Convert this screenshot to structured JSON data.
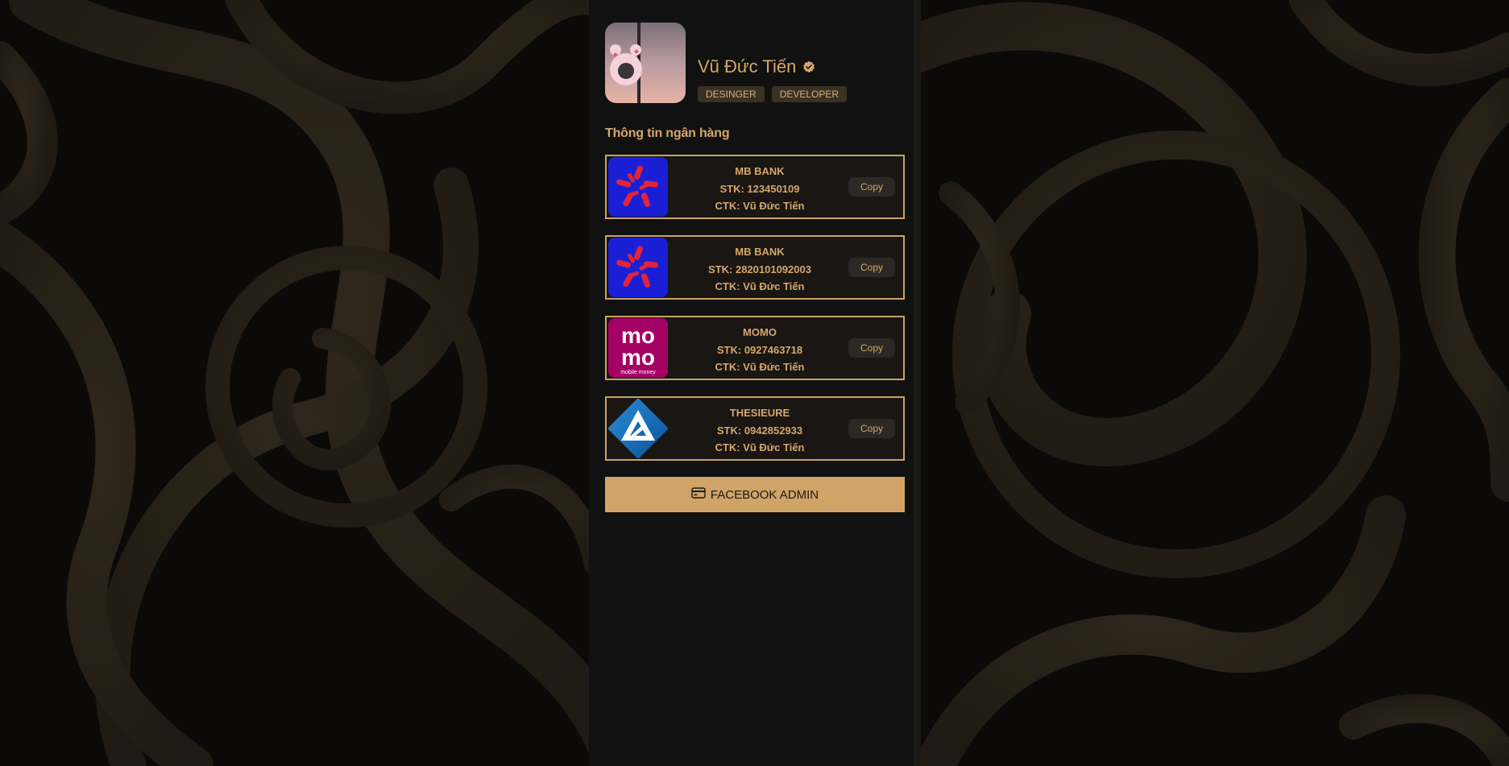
{
  "profile": {
    "name": "Vũ Đức Tiến",
    "verified_icon": "verified-check-icon",
    "tags": [
      "DESINGER",
      "DEVELOPER"
    ]
  },
  "section": {
    "title": "Thông tin ngân hàng"
  },
  "banks": [
    {
      "name": "MB BANK",
      "account": "STK: 123450109",
      "holder": "CTK: Vũ Đức Tiến",
      "logo": "mb-bank-logo",
      "copy_label": "Copy"
    },
    {
      "name": "MB BANK",
      "account": "STK: 2820101092003",
      "holder": "CTK: Vũ Đức Tiến",
      "logo": "mb-bank-logo",
      "copy_label": "Copy"
    },
    {
      "name": "MOMO",
      "account": "STK: 0927463718",
      "holder": "CTK: Vũ Đức Tiến",
      "logo": "momo-logo",
      "logo_text": [
        "mo",
        "mo",
        "mobile money"
      ],
      "copy_label": "Copy"
    },
    {
      "name": "THESIEURE",
      "account": "STK: 0942852933",
      "holder": "CTK: Vũ Đức Tiến",
      "logo": "thesieure-logo",
      "copy_label": "Copy"
    }
  ],
  "footer": {
    "facebook_label": "FACEBOOK ADMIN",
    "facebook_icon": "credit-card-icon"
  },
  "colors": {
    "accent": "#d6a76b",
    "button": "#cfa466",
    "panel": "#111111",
    "card_border": "#c9a364"
  }
}
